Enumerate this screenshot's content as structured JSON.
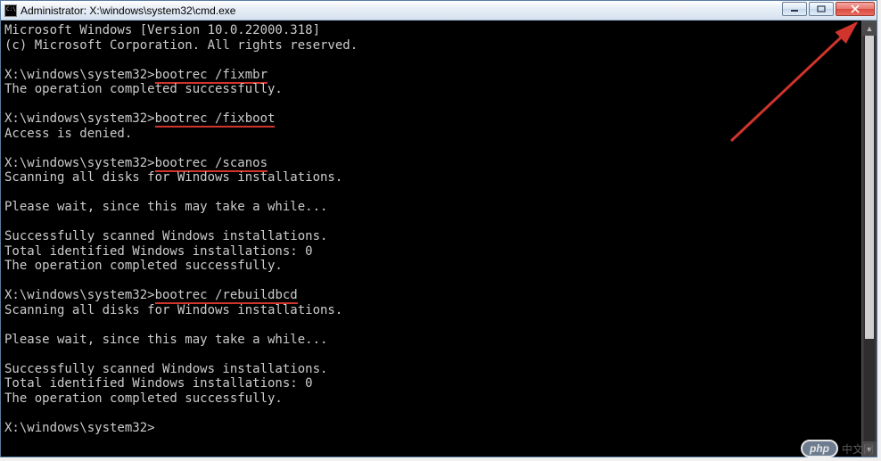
{
  "window": {
    "title": "Administrator: X:\\windows\\system32\\cmd.exe"
  },
  "terminal": {
    "prompt": "X:\\windows\\system32>",
    "header": [
      "Microsoft Windows [Version 10.0.22000.318]",
      "(c) Microsoft Corporation. All rights reserved."
    ],
    "blocks": [
      {
        "command": "bootrec /fixmbr",
        "underline": true,
        "output": [
          "The operation completed successfully."
        ]
      },
      {
        "command": "bootrec /fixboot",
        "underline": true,
        "output": [
          "Access is denied."
        ]
      },
      {
        "command": "bootrec /scanos",
        "underline": true,
        "output": [
          "Scanning all disks for Windows installations.",
          "",
          "Please wait, since this may take a while...",
          "",
          "Successfully scanned Windows installations.",
          "Total identified Windows installations: 0",
          "The operation completed successfully."
        ]
      },
      {
        "command": "bootrec /rebuildbcd",
        "underline": true,
        "output": [
          "Scanning all disks for Windows installations.",
          "",
          "Please wait, since this may take a while...",
          "",
          "Successfully scanned Windows installations.",
          "Total identified Windows installations: 0",
          "The operation completed successfully."
        ]
      }
    ],
    "final_prompt": "X:\\windows\\system32>"
  },
  "watermark": {
    "badge": "php",
    "text": "中文网"
  }
}
